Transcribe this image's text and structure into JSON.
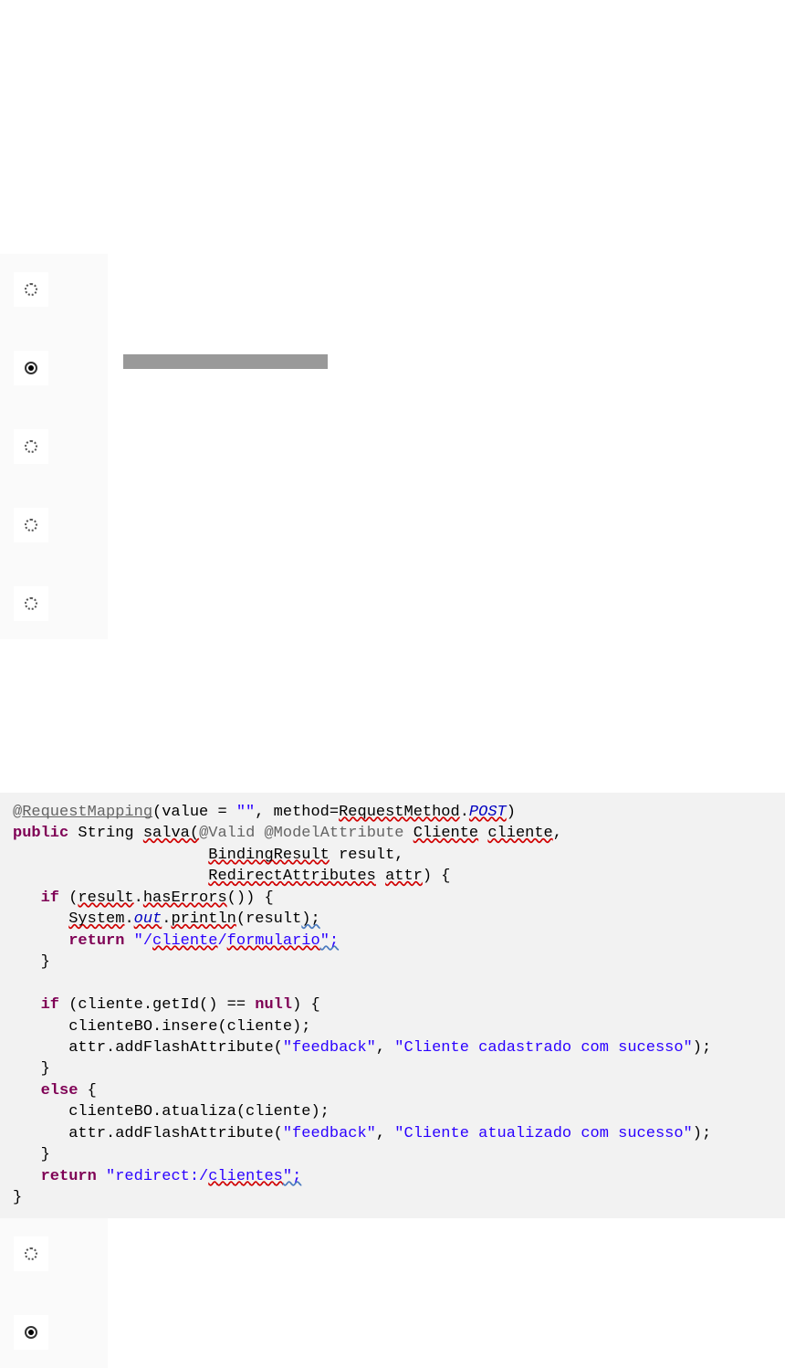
{
  "code": {
    "line1": {
      "at": "@",
      "reqmap": "RequestMapping",
      "lparen": "(value = ",
      "emptystr": "\"\"",
      "comma": ", method=",
      "reqmethod": "RequestMethod",
      "dot": ".",
      "post": "POST",
      "rparen": ")"
    },
    "line2": {
      "public": "public",
      "string": " String ",
      "salva": "salva(",
      "valid": "@Valid",
      "space": " ",
      "modelattr": "@ModelAttribute",
      "space2": " ",
      "cliente_type": "Cliente",
      "space3": " ",
      "cliente_var": "cliente",
      "comma": ","
    },
    "line3": {
      "indent": "                     ",
      "bindingresult": "BindingResult",
      "result": " result,"
    },
    "line4": {
      "indent": "                     ",
      "redirectattr": "RedirectAttributes",
      "space": " ",
      "attr": "attr",
      "rest": ") {"
    },
    "line5": {
      "indent": "   ",
      "if": "if",
      "lparen": " (",
      "result": "result",
      "dot": ".",
      "haserrors": "hasErrors",
      "rparen": "()) {"
    },
    "line6": {
      "indent": "      ",
      "system": "System",
      "dot": ".",
      "out": "out",
      "dot2": ".",
      "println": "println",
      "lparen": "(result",
      "rparen": ");"
    },
    "line7": {
      "indent": "      ",
      "return": "return",
      "space": " ",
      "str_open": "\"/",
      "cliente": "cliente",
      "slash": "/",
      "formulario": "formulario",
      "str_close": "\";"
    },
    "line8": {
      "indent": "   ",
      "brace": "}"
    },
    "line9": "",
    "line10": {
      "indent": "   ",
      "if": "if",
      "cond": " (cliente.getId() == ",
      "null": "null",
      "rest": ") {"
    },
    "line11": {
      "indent": "      ",
      "text": "clienteBO.insere(cliente);"
    },
    "line12": {
      "indent": "      ",
      "prefix": "attr.addFlashAttribute(",
      "str1": "\"feedback\"",
      "comma": ", ",
      "str2": "\"Cliente cadastrado com sucesso\"",
      "suffix": ");"
    },
    "line13": {
      "indent": "   ",
      "brace": "}"
    },
    "line14": {
      "indent": "   ",
      "else": "else",
      "brace": " {"
    },
    "line15": {
      "indent": "      ",
      "text": "clienteBO.atualiza(cliente);"
    },
    "line16": {
      "indent": "      ",
      "prefix": "attr.addFlashAttribute(",
      "str1": "\"feedback\"",
      "comma": ", ",
      "str2": "\"Cliente atualizado com sucesso\"",
      "suffix": ");"
    },
    "line17": {
      "indent": "   ",
      "brace": "}"
    },
    "line18": {
      "indent": "   ",
      "return": "return",
      "space": " ",
      "str_open": "\"redirect:/",
      "clientes": "clientes",
      "str_close": "\";"
    },
    "line19": {
      "brace": "}"
    }
  }
}
